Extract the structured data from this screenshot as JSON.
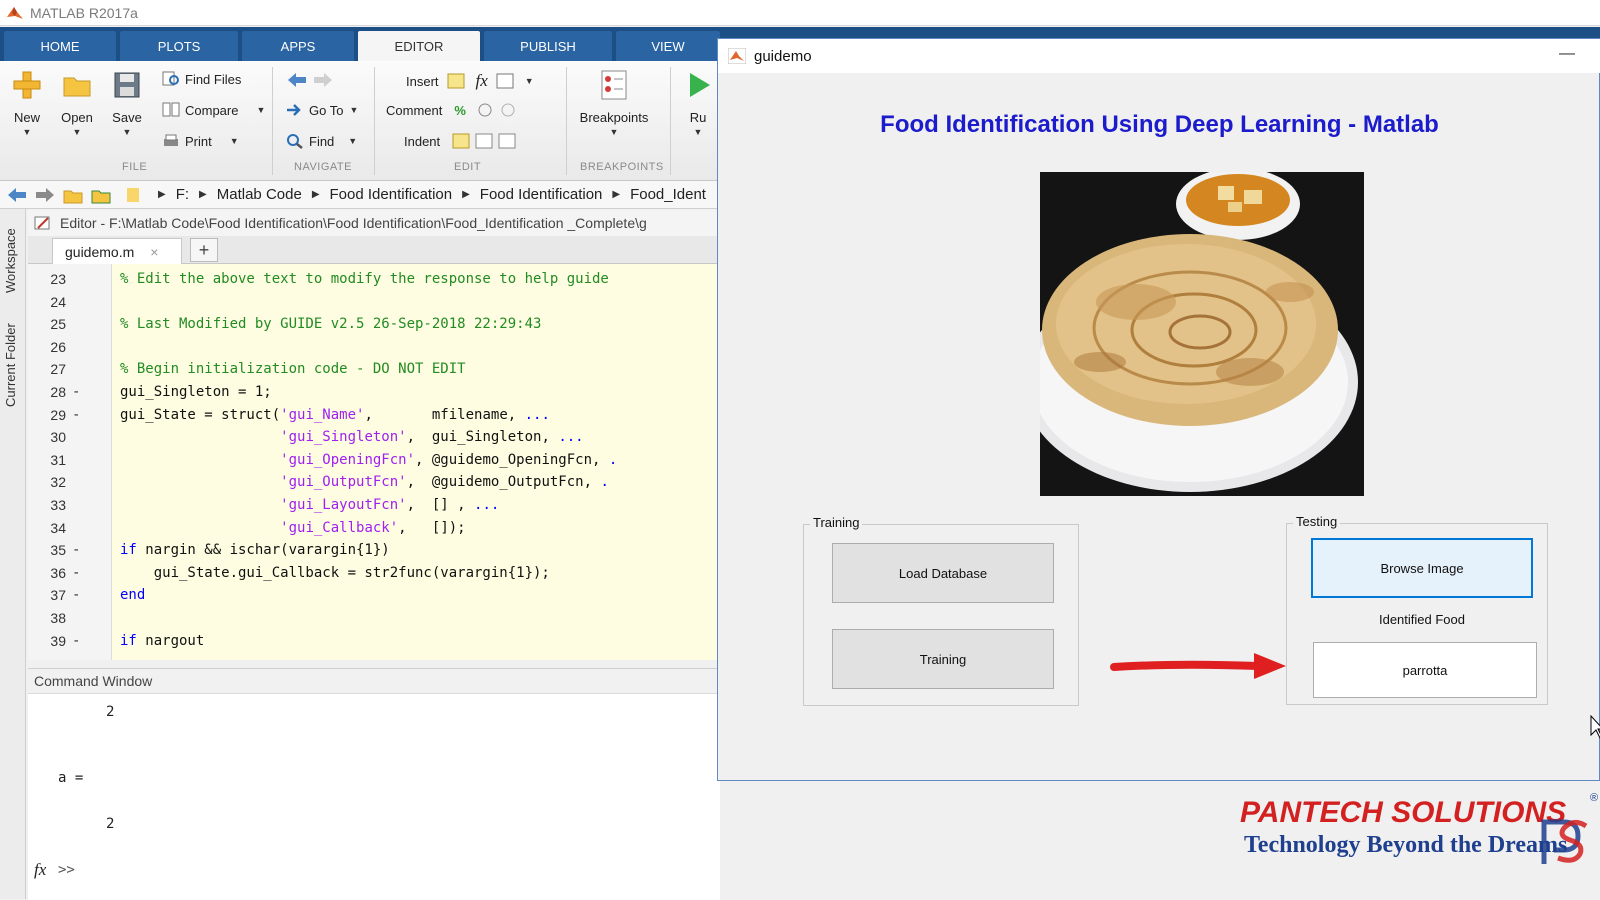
{
  "app": {
    "title": "MATLAB R2017a"
  },
  "ribbon_tabs": [
    {
      "label": "HOME"
    },
    {
      "label": "PLOTS"
    },
    {
      "label": "APPS"
    },
    {
      "label": "EDITOR"
    },
    {
      "label": "PUBLISH"
    },
    {
      "label": "VIEW"
    }
  ],
  "ribbon": {
    "file": {
      "new": "New",
      "open": "Open",
      "save": "Save",
      "find_files": "Find Files",
      "compare": "Compare",
      "print": "Print",
      "group": "FILE"
    },
    "navigate": {
      "go_to": "Go To",
      "find": "Find",
      "group": "NAVIGATE"
    },
    "edit": {
      "insert": "Insert",
      "comment": "Comment",
      "indent": "Indent",
      "fx": "fx",
      "percent": "%",
      "group": "EDIT"
    },
    "breakpoints": {
      "label": "Breakpoints",
      "group": "BREAKPOINTS"
    },
    "run": {
      "label": "Ru"
    }
  },
  "address": {
    "crumbs": [
      "F:",
      "Matlab Code",
      "Food Identification",
      "Food Identification",
      "Food_Ident"
    ]
  },
  "side": {
    "workspace": "Workspace",
    "current_folder": "Current Folder"
  },
  "editor": {
    "title": "Editor - F:\\Matlab Code\\Food Identification\\Food Identification\\Food_Identification _Complete\\g",
    "tab": "guidemo.m",
    "tab_close": "×",
    "new_tab": "+",
    "lines": [
      {
        "n": "23",
        "d": "",
        "parts": [
          {
            "c": "cm",
            "t": "% Edit the above text to modify the response to help guide"
          }
        ]
      },
      {
        "n": "24",
        "d": "",
        "parts": []
      },
      {
        "n": "25",
        "d": "",
        "parts": [
          {
            "c": "cm",
            "t": "% Last Modified by GUIDE v2.5 26-Sep-2018 22:29:43"
          }
        ]
      },
      {
        "n": "26",
        "d": "",
        "parts": []
      },
      {
        "n": "27",
        "d": "",
        "parts": [
          {
            "c": "cm",
            "t": "% Begin initialization code - DO NOT EDIT"
          }
        ]
      },
      {
        "n": "28",
        "d": "-",
        "parts": [
          {
            "c": "plain",
            "t": "gui_Singleton = 1;"
          }
        ]
      },
      {
        "n": "29",
        "d": "-",
        "parts": [
          {
            "c": "plain",
            "t": "gui_State = struct("
          },
          {
            "c": "str",
            "t": "'gui_Name'"
          },
          {
            "c": "plain",
            "t": ",       mfilename, "
          },
          {
            "c": "kw",
            "t": "..."
          }
        ]
      },
      {
        "n": "30",
        "d": "",
        "parts": [
          {
            "c": "plain",
            "t": "                   "
          },
          {
            "c": "str",
            "t": "'gui_Singleton'"
          },
          {
            "c": "plain",
            "t": ",  gui_Singleton, "
          },
          {
            "c": "kw",
            "t": "..."
          }
        ]
      },
      {
        "n": "31",
        "d": "",
        "parts": [
          {
            "c": "plain",
            "t": "                   "
          },
          {
            "c": "str",
            "t": "'gui_OpeningFcn'"
          },
          {
            "c": "plain",
            "t": ", @guidemo_OpeningFcn, "
          },
          {
            "c": "kw",
            "t": "."
          }
        ]
      },
      {
        "n": "32",
        "d": "",
        "parts": [
          {
            "c": "plain",
            "t": "                   "
          },
          {
            "c": "str",
            "t": "'gui_OutputFcn'"
          },
          {
            "c": "plain",
            "t": ",  @guidemo_OutputFcn, "
          },
          {
            "c": "kw",
            "t": "."
          }
        ]
      },
      {
        "n": "33",
        "d": "",
        "parts": [
          {
            "c": "plain",
            "t": "                   "
          },
          {
            "c": "str",
            "t": "'gui_LayoutFcn'"
          },
          {
            "c": "plain",
            "t": ",  [] , "
          },
          {
            "c": "kw",
            "t": "..."
          }
        ]
      },
      {
        "n": "34",
        "d": "",
        "parts": [
          {
            "c": "plain",
            "t": "                   "
          },
          {
            "c": "str",
            "t": "'gui_Callback'"
          },
          {
            "c": "plain",
            "t": ",   []);"
          }
        ]
      },
      {
        "n": "35",
        "d": "-",
        "parts": [
          {
            "c": "kw",
            "t": "if"
          },
          {
            "c": "plain",
            "t": " nargin && ischar(varargin{1})"
          }
        ]
      },
      {
        "n": "36",
        "d": "-",
        "parts": [
          {
            "c": "plain",
            "t": "    gui_State.gui_Callback = str2func(varargin{1});"
          }
        ]
      },
      {
        "n": "37",
        "d": "-",
        "parts": [
          {
            "c": "kw",
            "t": "end"
          }
        ]
      },
      {
        "n": "38",
        "d": "",
        "parts": []
      },
      {
        "n": "39",
        "d": "-",
        "parts": [
          {
            "c": "kw",
            "t": "if"
          },
          {
            "c": "plain",
            "t": " nargout"
          }
        ]
      }
    ]
  },
  "command_window": {
    "title": "Command Window",
    "lines": [
      "2",
      "a =",
      "2"
    ],
    "prompt": ">>",
    "fx": "fx"
  },
  "guidemo": {
    "title": "guidemo",
    "minimize": "—",
    "heading": "Food Identification Using Deep Learning - Matlab",
    "training": {
      "label": "Training",
      "load_database": "Load Database",
      "training_button": "Training"
    },
    "testing": {
      "label": "Testing",
      "browse_image": "Browse Image",
      "identified_label": "Identified Food",
      "result": "parrotta"
    }
  },
  "logo": {
    "brand": "PANTECH SOLUTIONS",
    "tagline": "Technology Beyond the Dreams",
    "reg": "®"
  },
  "colors": {
    "matlab_tab_blue": "#1b4f86",
    "heading_blue": "#1c1ccc",
    "arrow_red": "#e02020",
    "logo_red": "#d32020",
    "logo_blue": "#1f3f8f"
  }
}
